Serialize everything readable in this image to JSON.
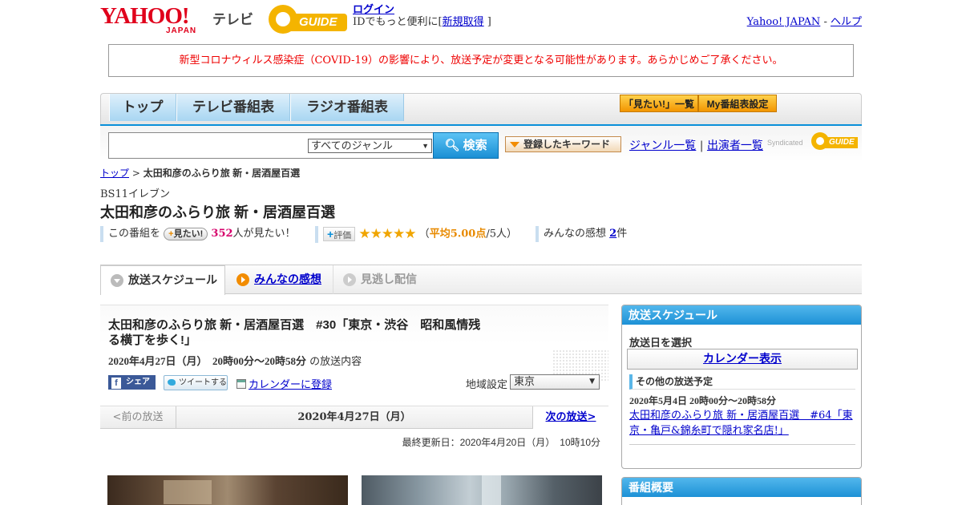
{
  "header": {
    "logo_yahoo": "YAHOO!",
    "logo_japan": "JAPAN",
    "logo_tv": "テレビ",
    "gguide_logo": "GUIDE",
    "login_label": "ログイン",
    "id_text_pre": "IDでもっと便利に[",
    "signup_label": "新規取得",
    "id_text_post": "]",
    "yahoo_japan_link": "Yahoo! JAPAN",
    "separator": "-",
    "help_link": "ヘルプ"
  },
  "notice": {
    "text": "新型コロナウィルス感染症（COVID-19）の影響により、放送予定が変更となる可能性があります。あらかじめご了承ください。"
  },
  "nav": {
    "tabs": [
      {
        "label": "トップ"
      },
      {
        "label": "テレビ番組表"
      },
      {
        "label": "ラジオ番組表"
      }
    ],
    "mitai_list": "「見たい!」一覧",
    "my_schedule": "My番組表設定"
  },
  "search": {
    "query": "",
    "genre": "すべてのジャンル",
    "button": "検索",
    "keyword_button": "登録したキーワード",
    "genre_list": "ジャンル一覧",
    "link_sep": "|",
    "performer_list": "出演者一覧",
    "syndicated": "Syndicated",
    "gguide": "GUIDE"
  },
  "breadcrumb": {
    "top": "トップ",
    "sep": ">",
    "current": "太田和彦のふらり旅 新・居酒屋百選"
  },
  "program": {
    "channel": "BS11イレブン",
    "title": "太田和彦のふらり旅 新・居酒屋百選"
  },
  "rating": {
    "prefix": "この番組を",
    "mitai_button": "見たい!",
    "mitai_count": "352",
    "mitai_suffix": "人が見たい！",
    "hyoka_button": "評価",
    "stars": "★★★★★",
    "avg_open": "（",
    "avg": "平均5.00点",
    "avg_people": "/5人）",
    "impressions_prefix": "みんなの感想",
    "impressions_count": "2",
    "impressions_suffix": "件"
  },
  "tabs": [
    {
      "label": "放送スケジュール"
    },
    {
      "label": "みんなの感想"
    },
    {
      "label": "見逃し配信"
    }
  ],
  "episode": {
    "title": "太田和彦のふらり旅 新・居酒屋百選　#30「東京・渋谷　昭和風情残る横丁を歩く!」",
    "date": "2020年4月27日（月）　20時00分～20時58分",
    "date_suffix": "の放送内容",
    "share_fb": "シェア",
    "share_tw": "ツイートする",
    "calendar_register": "カレンダーに登録",
    "region_label": "地域設定",
    "region": "東京"
  },
  "prevnext": {
    "prev": "<前の放送",
    "current": "2020年4月27日（月）",
    "next": "次の放送>"
  },
  "updated": "最終更新日：2020年4月20日（月）　10時10分",
  "sidebar": {
    "schedule_title": "放送スケジュール",
    "select_date": "放送日を選択",
    "calendar_button": "カレンダー表示",
    "other_heading": "その他の放送予定",
    "other_date": "2020年5月4日  20時00分～20時58分",
    "other_link": "太田和彦のふらり旅 新・居酒屋百選　#64「東京・亀戸&錦糸町で隠れ家名店!」",
    "overview_title": "番組概要"
  }
}
